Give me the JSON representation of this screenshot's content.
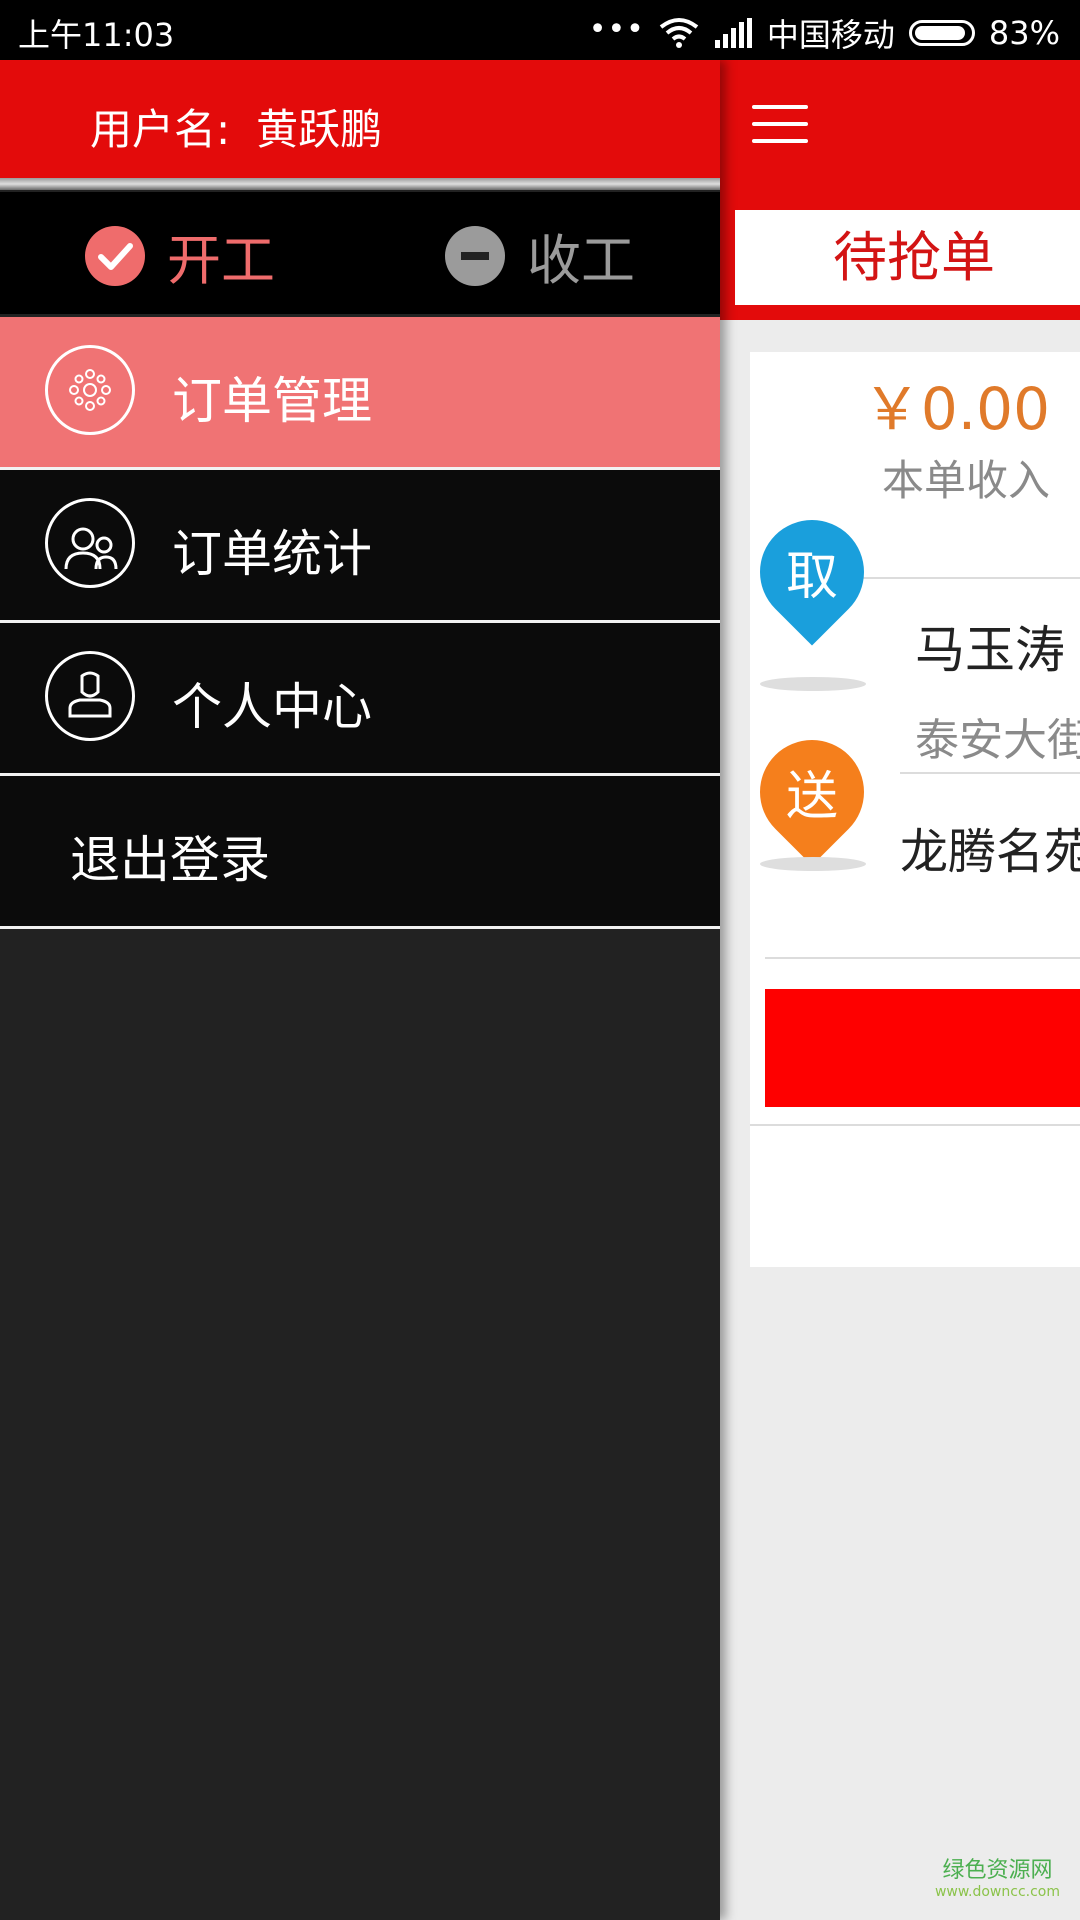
{
  "status_bar": {
    "time": "上午11:03",
    "dots": "•••",
    "carrier": "中国移动",
    "battery": "83%",
    "battery_level": 0.83
  },
  "drawer": {
    "username_label": "用户名:",
    "username": "黄跃鹏",
    "start_work": "开工",
    "stop_work": "收工",
    "menu": [
      {
        "label": "订单管理",
        "icon": "dots-ring-icon",
        "active": true
      },
      {
        "label": "订单统计",
        "icon": "people-icon",
        "active": false
      },
      {
        "label": "个人中心",
        "icon": "user-icon",
        "active": false
      }
    ],
    "logout": "退出登录"
  },
  "main": {
    "tab": "待抢单",
    "order": {
      "price": "￥0.00",
      "price_label": "本单收入",
      "pickup_badge": "取",
      "pickup_name": "马玉涛",
      "pickup_addr": "泰安大街",
      "deliver_badge": "送",
      "deliver_name": "龙腾名苑"
    }
  },
  "colors": {
    "brand_red": "#e30b0b",
    "active_pink": "#f07374",
    "price_orange": "#e07a2a",
    "pickup_blue": "#1a9fdc",
    "deliver_orange": "#f57f1c"
  },
  "watermark": {
    "cn": "绿色资源网",
    "url": "www.downcc.com"
  }
}
